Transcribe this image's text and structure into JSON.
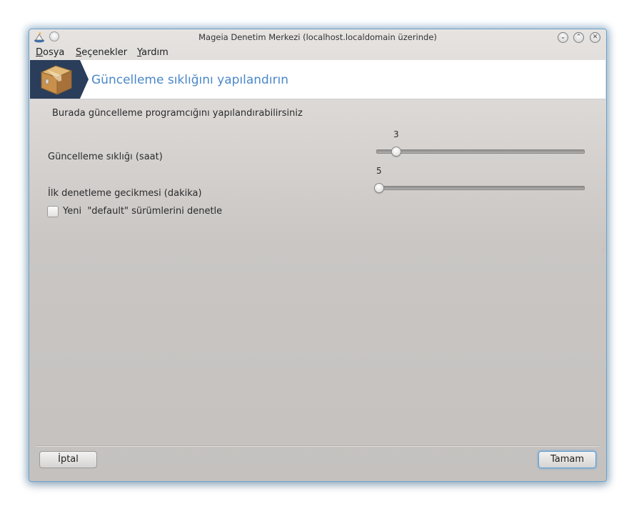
{
  "window": {
    "title": "Mageia Denetim Merkezi  (localhost.localdomain üzerinde)",
    "buttons": {
      "minimize_glyph": "⌄",
      "maximize_glyph": "⌃",
      "close_glyph": "✕"
    }
  },
  "menubar": {
    "items": [
      {
        "mnemonic": "D",
        "rest": "osya"
      },
      {
        "mnemonic": "S",
        "rest": "eçenekler"
      },
      {
        "mnemonic": "Y",
        "rest": "ardım"
      }
    ]
  },
  "banner": {
    "title": "Güncelleme sıklığını yapılandırın",
    "icon": "package-box-icon"
  },
  "intro_text": "Burada güncelleme programcığını yapılandırabilirsiniz",
  "settings": {
    "frequency": {
      "label": "Güncelleme sıklığı (saat)",
      "value": "3",
      "min": 1,
      "max": 24
    },
    "delay": {
      "label": "İlk denetleme gecikmesi (dakika)",
      "value": "5",
      "min": 5,
      "max": 60
    }
  },
  "checkbox": {
    "label": "Yeni  \"default\" sürümlerini denetle",
    "checked": false
  },
  "buttons": {
    "cancel": "İptal",
    "ok": "Tamam"
  },
  "colors": {
    "accent": "#4a87c8",
    "banner_dark": "#2a3d5a",
    "focus": "#5fa0d8"
  }
}
